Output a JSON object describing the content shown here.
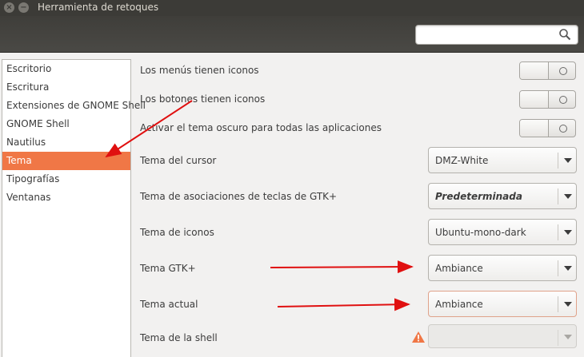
{
  "window": {
    "title": "Herramienta de retoques"
  },
  "search": {
    "placeholder": ""
  },
  "sidebar": {
    "items": [
      {
        "label": "Escritorio"
      },
      {
        "label": "Escritura"
      },
      {
        "label": "Extensiones de GNOME Shell"
      },
      {
        "label": "GNOME Shell"
      },
      {
        "label": "Nautilus"
      },
      {
        "label": "Tema",
        "selected": true
      },
      {
        "label": "Tipografías"
      },
      {
        "label": "Ventanas"
      }
    ]
  },
  "settings": {
    "menus_icons": {
      "label": "Los menús tienen iconos",
      "state": "off"
    },
    "buttons_icons": {
      "label": "Los botones tienen iconos",
      "state": "off"
    },
    "dark_theme": {
      "label": "Activar el tema oscuro para todas las aplicaciones",
      "state": "off"
    },
    "cursor_theme": {
      "label": "Tema del cursor",
      "value": "DMZ-White"
    },
    "keys_theme": {
      "label": "Tema de asociaciones de teclas de GTK+",
      "value": "Predeterminada"
    },
    "icon_theme": {
      "label": "Tema de iconos",
      "value": "Ubuntu-mono-dark"
    },
    "gtk_theme": {
      "label": "Tema GTK+",
      "value": "Ambiance"
    },
    "current_theme": {
      "label": "Tema actual",
      "value": "Ambiance"
    },
    "shell_theme": {
      "label": "Tema de la shell",
      "value": "",
      "disabled": true,
      "warning": true
    }
  },
  "colors": {
    "accent": "#f07746",
    "annotation_arrow": "#e01010",
    "titlebar": "#3c3b37",
    "warning": "#f07746"
  },
  "icons": {
    "search": "search-icon",
    "warning": "warning-icon",
    "close": "close-icon",
    "minimize": "minimize-icon"
  }
}
